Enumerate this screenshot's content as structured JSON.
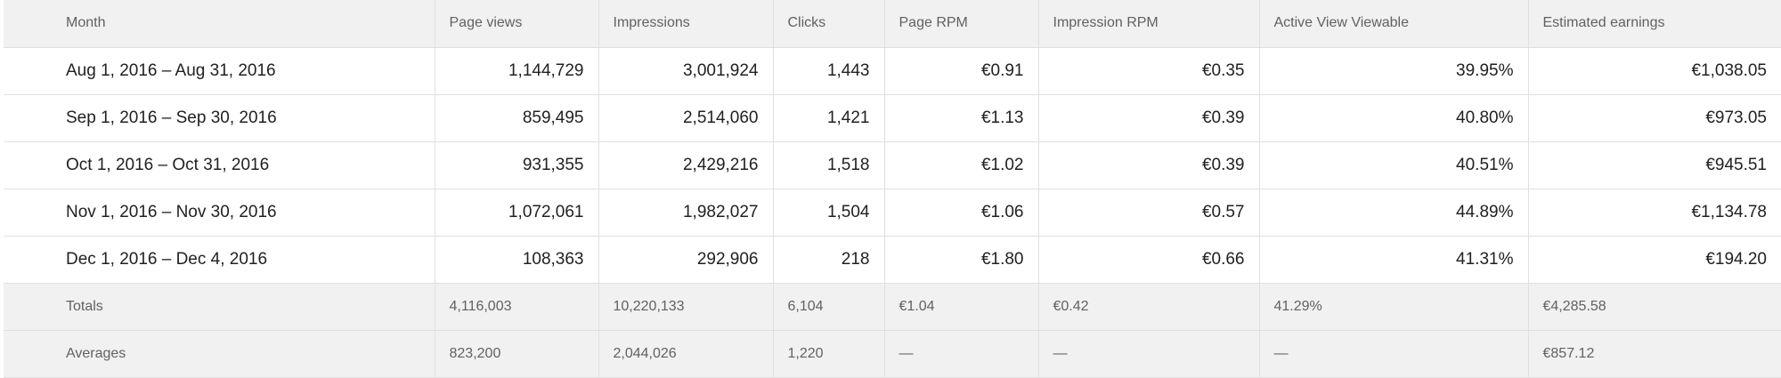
{
  "columns": [
    "Month",
    "Page views",
    "Impressions",
    "Clicks",
    "Page RPM",
    "Impression RPM",
    "Active View Viewable",
    "Estimated earnings"
  ],
  "rows": [
    {
      "month": "Aug 1, 2016 – Aug 31, 2016",
      "page_views": "1,144,729",
      "impressions": "3,001,924",
      "clicks": "1,443",
      "page_rpm": "€0.91",
      "impression_rpm": "€0.35",
      "active_view": "39.95%",
      "earnings": "€1,038.05"
    },
    {
      "month": "Sep 1, 2016 – Sep 30, 2016",
      "page_views": "859,495",
      "impressions": "2,514,060",
      "clicks": "1,421",
      "page_rpm": "€1.13",
      "impression_rpm": "€0.39",
      "active_view": "40.80%",
      "earnings": "€973.05"
    },
    {
      "month": "Oct 1, 2016 – Oct 31, 2016",
      "page_views": "931,355",
      "impressions": "2,429,216",
      "clicks": "1,518",
      "page_rpm": "€1.02",
      "impression_rpm": "€0.39",
      "active_view": "40.51%",
      "earnings": "€945.51"
    },
    {
      "month": "Nov 1, 2016 – Nov 30, 2016",
      "page_views": "1,072,061",
      "impressions": "1,982,027",
      "clicks": "1,504",
      "page_rpm": "€1.06",
      "impression_rpm": "€0.57",
      "active_view": "44.89%",
      "earnings": "€1,134.78"
    },
    {
      "month": "Dec 1, 2016 – Dec 4, 2016",
      "page_views": "108,363",
      "impressions": "292,906",
      "clicks": "218",
      "page_rpm": "€1.80",
      "impression_rpm": "€0.66",
      "active_view": "41.31%",
      "earnings": "€194.20"
    }
  ],
  "totals": {
    "label": "Totals",
    "page_views": "4,116,003",
    "impressions": "10,220,133",
    "clicks": "6,104",
    "page_rpm": "€1.04",
    "impression_rpm": "€0.42",
    "active_view": "41.29%",
    "earnings": "€4,285.58"
  },
  "averages": {
    "label": "Averages",
    "page_views": "823,200",
    "impressions": "2,044,026",
    "clicks": "1,220",
    "page_rpm": "—",
    "impression_rpm": "—",
    "active_view": "—",
    "earnings": "€857.12"
  }
}
